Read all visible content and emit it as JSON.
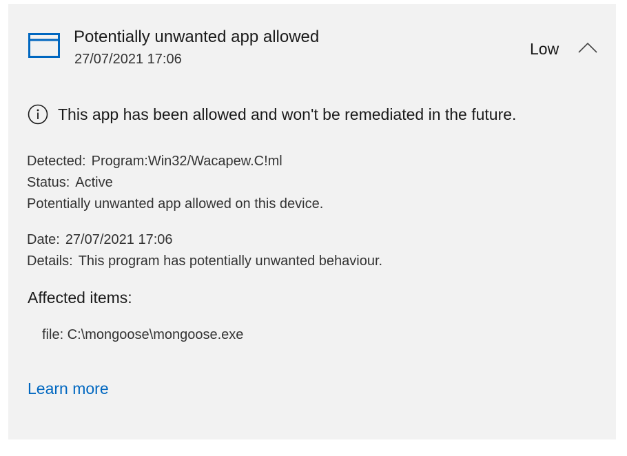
{
  "threat": {
    "title": "Potentially unwanted app allowed",
    "timestamp": "27/07/2021 17:06",
    "severity": "Low",
    "icon": "app-window-icon",
    "toggle_icon": "chevron-up-icon"
  },
  "info": {
    "icon": "info-icon",
    "message": "This app has been allowed and won't be remediated in the future."
  },
  "details": {
    "detected_label": "Detected:",
    "detected_value": "Program:Win32/Wacapew.C!ml",
    "status_label": "Status:",
    "status_value": "Active",
    "description": "Potentially unwanted app allowed on this device.",
    "date_label": "Date:",
    "date_value": "27/07/2021 17:06",
    "details_label": "Details:",
    "details_value": "This program has potentially unwanted behaviour."
  },
  "affected": {
    "title": "Affected items:",
    "items": [
      "file: C:\\mongoose\\mongoose.exe"
    ]
  },
  "links": {
    "learn_more": "Learn more"
  },
  "colors": {
    "accent": "#0067c0",
    "card_background": "#f2f2f2"
  }
}
